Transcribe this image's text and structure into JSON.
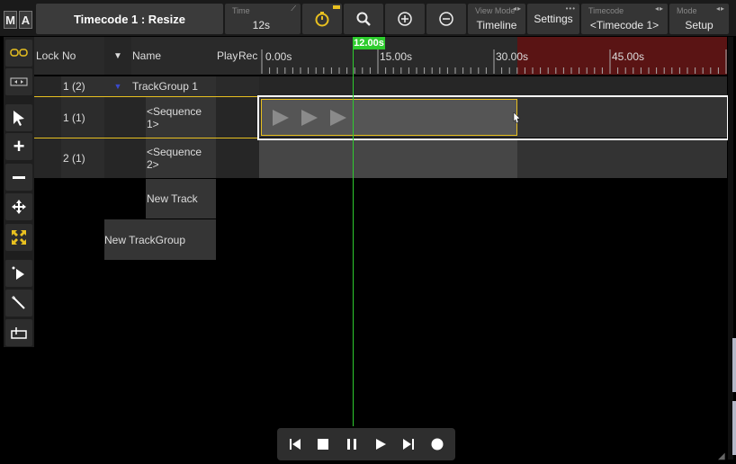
{
  "logo": {
    "m": "M",
    "a": "A"
  },
  "window_title": "Timecode 1 : Resize",
  "toolbar": {
    "time_label": "Time",
    "time_value": "12s",
    "view_mode_label": "View Mode",
    "view_mode_value": "Timeline",
    "settings_label": "Settings",
    "timecode_label": "Timecode",
    "timecode_value": "<Timecode 1>",
    "mode_label": "Mode",
    "mode_value": "Setup"
  },
  "columns": {
    "lock": "Lock",
    "no": "No",
    "name": "Name",
    "play": "Play",
    "rec": "Rec"
  },
  "ruler": {
    "ticks": [
      "0.00s",
      "15.00s",
      "30.00s",
      "45.00s"
    ],
    "playhead_label": "12.00s"
  },
  "rows": [
    {
      "no": "1 (2)",
      "name": "TrackGroup 1"
    },
    {
      "no": "1 (1)",
      "name": "<Sequence 1>"
    },
    {
      "no": "2 (1)",
      "name": "<Sequence 2>"
    }
  ],
  "new_track": "New Track",
  "new_trackgroup": "New TrackGroup",
  "colors": {
    "accent_yellow": "#e8c020",
    "playhead_green": "#2ecc2e",
    "red_zone": "#5a1414"
  }
}
